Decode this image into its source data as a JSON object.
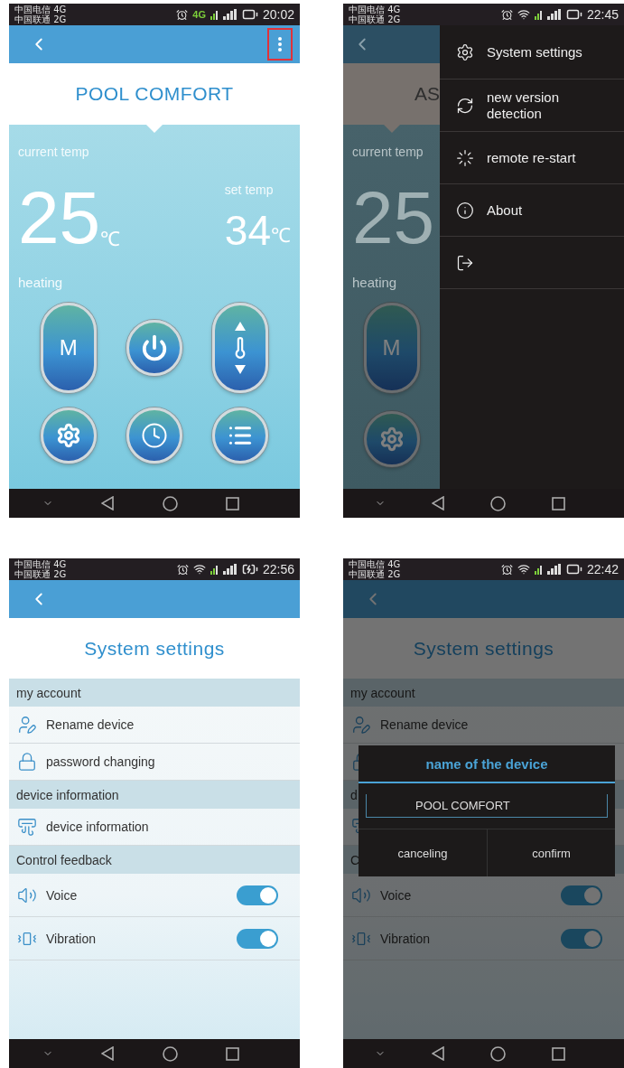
{
  "main_screen": {
    "status_bar": {
      "carriers": [
        "中国电信 4G",
        "中国联通 2G"
      ],
      "network": "4G",
      "charging": false,
      "time": "20:02"
    },
    "menu_button": {
      "highlighted": true
    },
    "title": "POOL COMFORT",
    "current_temp_label": "current temp",
    "current_temp": "25",
    "current_unit": "℃",
    "set_temp_label": "set temp",
    "set_temp": "34",
    "set_unit": "℃",
    "mode": "heating",
    "mode_button": "M"
  },
  "menu_screen": {
    "status_bar": {
      "carriers": [
        "中国电信 4G",
        "中国联通 2G"
      ],
      "charging": false,
      "time": "22:45"
    },
    "background": {
      "title": "AS",
      "current_temp_label": "current temp",
      "current_temp": "25",
      "mode": "heating",
      "mode_button": "M"
    },
    "menu": [
      {
        "kind": "settings",
        "label": "System settings"
      },
      {
        "kind": "update",
        "label": "new version detection"
      },
      {
        "kind": "restart",
        "label": "remote re-start"
      },
      {
        "kind": "about",
        "label": "About"
      },
      {
        "kind": "exit"
      }
    ]
  },
  "settings_screen": {
    "status_bar": {
      "carriers": [
        "中国电信 4G",
        "中国联通 2G"
      ],
      "charging": true,
      "time": "22:56"
    },
    "title": "System settings",
    "sections": [
      {
        "header": "my account",
        "rows": [
          {
            "kind": "rename",
            "label": "Rename device"
          },
          {
            "kind": "password",
            "label": "password changing"
          }
        ]
      },
      {
        "header": "device information",
        "rows": [
          {
            "kind": "device",
            "label": "device information"
          }
        ]
      },
      {
        "header": "Control feedback",
        "rows": [
          {
            "kind": "voice",
            "label": "Voice",
            "on": true
          },
          {
            "kind": "vibration",
            "label": "Vibration",
            "on": true
          }
        ]
      }
    ]
  },
  "dialog_screen": {
    "status_bar": {
      "carriers": [
        "中国电信 4G",
        "中国联通 2G"
      ],
      "charging": false,
      "time": "22:42"
    },
    "background": {
      "title": "System settings",
      "sections": [
        {
          "header": "my account",
          "rows": [
            {
              "kind": "rename",
              "label": "Rename device"
            },
            {
              "kind": "password"
            }
          ]
        },
        {
          "header": "d",
          "rows": [
            {
              "kind": "device"
            }
          ]
        },
        {
          "header": "C",
          "rows": [
            {
              "kind": "voice",
              "label": "Voice",
              "on": true
            },
            {
              "kind": "vibration",
              "label": "Vibration",
              "on": true
            }
          ]
        }
      ]
    },
    "dialog": {
      "title": "name of the device",
      "value": "POOL COMFORT",
      "buttons": [
        "canceling",
        "confirm"
      ]
    }
  }
}
